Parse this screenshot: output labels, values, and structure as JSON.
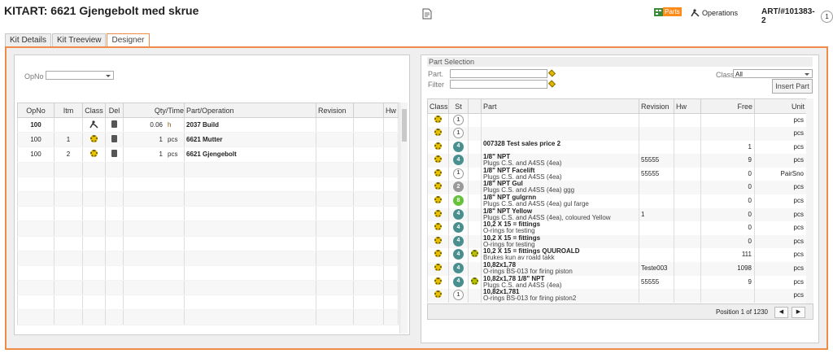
{
  "header": {
    "title": "KITART: 6621 Gjengebolt med skrue",
    "parts_label": "Parts",
    "operations_label": "Operations",
    "art_number": "ART/#101383-2",
    "art_count": "1"
  },
  "tabs": [
    {
      "label": "Kit Details"
    },
    {
      "label": "Kit Treeview"
    },
    {
      "label": "Designer"
    }
  ],
  "designer": {
    "opno_label": "OpNo",
    "opno_value": "",
    "columns": [
      "OpNo",
      "Itm",
      "Class",
      "Del",
      "Qty/Time",
      "Part/Operation",
      "Revision",
      "",
      "Hw"
    ],
    "rows": [
      {
        "opno": "100",
        "itm": "",
        "cls": "operation",
        "qty": "0.06",
        "unit": "h",
        "part": "2037 Build",
        "bold": true
      },
      {
        "opno": "100",
        "itm": "1",
        "cls": "gear",
        "qty": "1",
        "unit": "pcs",
        "part": "6621 Mutter",
        "bold": false
      },
      {
        "opno": "100",
        "itm": "2",
        "cls": "gear",
        "qty": "1",
        "unit": "pcs",
        "part": "6621 Gjengebolt",
        "bold": false
      }
    ]
  },
  "part_selection": {
    "title": "Part Selection",
    "part_label": "Part.",
    "filter_label": "Filter",
    "class_label": "Class",
    "class_value": "All",
    "insert_label": "Insert Part",
    "columns": [
      "Class",
      "St",
      "",
      "Part",
      "Revision",
      "Hw",
      "Free",
      "Unit"
    ],
    "rows": [
      {
        "st": "1",
        "st_color": "#ffffff",
        "extra": false,
        "line1": "",
        "line2": "",
        "revision": "",
        "free": "",
        "unit": "pcs"
      },
      {
        "st": "1",
        "st_color": "#ffffff",
        "extra": false,
        "line1": "",
        "line2": "",
        "revision": "",
        "free": "",
        "unit": "pcs"
      },
      {
        "st": "4",
        "st_color": "#4a8f8f",
        "extra": false,
        "line1": "007328 Test sales price 2",
        "line2": "",
        "revision": "",
        "free": "1",
        "unit": "pcs"
      },
      {
        "st": "4",
        "st_color": "#4a8f8f",
        "extra": false,
        "line1": "1/8\" NPT",
        "line2": "Plugs C.S. and A4SS (4ea)",
        "revision": "55555",
        "free": "9",
        "unit": "pcs"
      },
      {
        "st": "1",
        "st_color": "#ffffff",
        "extra": false,
        "line1": "1/8\" NPT Facelift",
        "line2": "Plugs C.S. and A4SS (4ea)",
        "revision": "55555",
        "free": "0",
        "unit": "PairSno"
      },
      {
        "st": "2",
        "st_color": "#9a9a9a",
        "extra": false,
        "line1": "1/8\" NPT Gul",
        "line2": "Plugs C.S. and A4SS (4ea) ggg",
        "revision": "",
        "free": "0",
        "unit": "pcs"
      },
      {
        "st": "8",
        "st_color": "#66c23a",
        "extra": false,
        "line1": "1/8\" NPT gulgrnn",
        "line2": "Plugs C.S. and A4SS (4ea) gul farge",
        "revision": "",
        "free": "0",
        "unit": "pcs"
      },
      {
        "st": "4",
        "st_color": "#4a8f8f",
        "extra": false,
        "line1": "1/8\" NPT Yellow",
        "line2": "Plugs C.S. and A4SS (4ea), coloured Yellow",
        "revision": "1",
        "free": "0",
        "unit": "pcs"
      },
      {
        "st": "4",
        "st_color": "#4a8f8f",
        "extra": false,
        "line1": "10,2 X 15 = fittings",
        "line2": "O-rings for testing",
        "revision": "",
        "free": "0",
        "unit": "pcs"
      },
      {
        "st": "4",
        "st_color": "#4a8f8f",
        "extra": false,
        "line1": "10,2 X 15 = fittings",
        "line2": "O-rings for testing",
        "revision": "",
        "free": "0",
        "unit": "pcs"
      },
      {
        "st": "4",
        "st_color": "#4a8f8f",
        "extra": true,
        "line1": "10,2 X 15 = fittings QUUROALD",
        "line2": "Brukes kun av roald takk",
        "revision": "",
        "free": "111",
        "unit": "pcs"
      },
      {
        "st": "4",
        "st_color": "#4a8f8f",
        "extra": false,
        "line1": "10,82x1,78",
        "line2": "O-rings BS-013 for firing piston",
        "revision": "Teste003",
        "free": "1098",
        "unit": "pcs"
      },
      {
        "st": "4",
        "st_color": "#4a8f8f",
        "extra": true,
        "line1": "10,82x1,78 1/8\" NPT",
        "line2": "Plugs C.S. and A4SS (4ea)",
        "revision": "55555",
        "free": "9",
        "unit": "pcs"
      },
      {
        "st": "1",
        "st_color": "#ffffff",
        "extra": false,
        "line1": "10,82x1,781",
        "line2": "O-rings BS-013 for firing piston2",
        "revision": "",
        "free": "",
        "unit": "pcs"
      }
    ],
    "position_text": "Position 1 of 1230"
  }
}
